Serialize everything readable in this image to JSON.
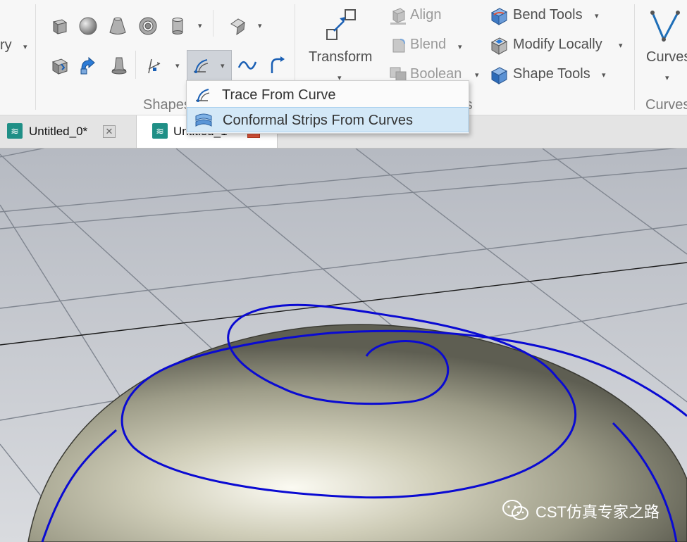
{
  "ribbon": {
    "partial_left_label": "ry",
    "shapes_group_label": "Shapes",
    "tools_group_label": "ols",
    "transform_label": "Transform",
    "align_label": "Align",
    "blend_label": "Blend",
    "boolean_label": "Boolean",
    "bend_tools_label": "Bend Tools",
    "modify_locally_label": "Modify Locally",
    "shape_tools_label": "Shape Tools",
    "curves_label": "Curves",
    "curves_group_label": "Curves"
  },
  "dropdown_menu": {
    "items": [
      {
        "label": "Trace From Curve",
        "icon": "trace-curve-icon"
      },
      {
        "label": "Conformal Strips From Curves",
        "icon": "conformal-strips-icon"
      }
    ]
  },
  "tabs": [
    {
      "label": "Untitled_0*",
      "active": false
    },
    {
      "label": "Untitled_1*",
      "active": true
    }
  ],
  "watermark": {
    "text": "CST仿真专家之路"
  },
  "colors": {
    "accent_blue": "#1a5fb4",
    "tab_icon": "#1f8f86",
    "active_tab_close": "#e0553a",
    "spiral_curve": "#0a0ad2",
    "menu_highlight": "#d3e8f7"
  }
}
